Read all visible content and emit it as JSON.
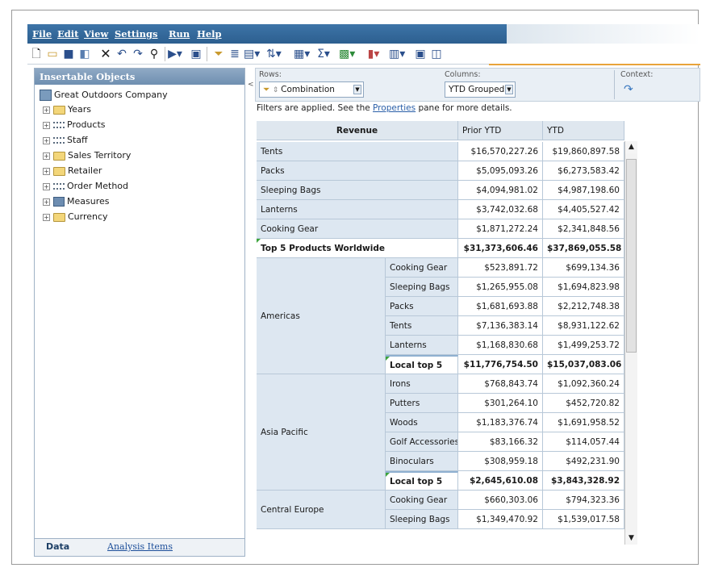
{
  "menu": {
    "file": "File",
    "edit": "Edit",
    "view": "View",
    "settings": "Settings",
    "run": "Run",
    "help": "Help"
  },
  "toolbar": {
    "icons": [
      "new-icon",
      "open-icon",
      "save-icon",
      "save-as-icon",
      "delete-icon",
      "undo-icon",
      "redo-icon",
      "find-icon",
      "run-icon",
      "export-icon",
      "filter-icon",
      "suppress-icon",
      "explore-icon",
      "sort-icon",
      "chart-type-icon",
      "summarize-icon",
      "insert-chart-icon",
      "chart-icon",
      "display-icon",
      "calculate-icon",
      "insert-member-icon"
    ]
  },
  "left_panel": {
    "title": "Insertable Objects",
    "root": "Great Outdoors Company",
    "items": [
      {
        "label": "Years",
        "icon": "folder-icon"
      },
      {
        "label": "Products",
        "icon": "hierarchy-icon"
      },
      {
        "label": "Staff",
        "icon": "hierarchy-icon"
      },
      {
        "label": "Sales Territory",
        "icon": "folder-icon"
      },
      {
        "label": "Retailer",
        "icon": "folder-icon"
      },
      {
        "label": "Order Method",
        "icon": "hierarchy-icon"
      },
      {
        "label": "Measures",
        "icon": "measures-icon"
      },
      {
        "label": "Currency",
        "icon": "folder-icon"
      }
    ],
    "tabs": {
      "data": "Data",
      "analysis": "Analysis Items"
    }
  },
  "overview": {
    "rows_label": "Rows:",
    "rows_value": "Combination",
    "columns_label": "Columns:",
    "columns_value": "YTD Grouped",
    "context_label": "Context:"
  },
  "filters": {
    "prefix": "Filters are applied. See the ",
    "link": "Properties",
    "suffix": " pane for more details."
  },
  "crosstab": {
    "corner": "Revenue",
    "col1": "Prior YTD",
    "col2": "YTD",
    "top_rows": [
      {
        "label": "Tents",
        "prior": "$16,570,227.26",
        "ytd": "$19,860,897.58"
      },
      {
        "label": "Packs",
        "prior": "$5,095,093.26",
        "ytd": "$6,273,583.42"
      },
      {
        "label": "Sleeping Bags",
        "prior": "$4,094,981.02",
        "ytd": "$4,987,198.60"
      },
      {
        "label": "Lanterns",
        "prior": "$3,742,032.68",
        "ytd": "$4,405,527.42"
      },
      {
        "label": "Cooking Gear",
        "prior": "$1,871,272.24",
        "ytd": "$2,341,848.56"
      }
    ],
    "top_total": {
      "label": "Top 5 Products Worldwide",
      "prior": "$31,373,606.46",
      "ytd": "$37,869,055.58"
    },
    "groups": [
      {
        "name": "Americas",
        "rows": [
          {
            "label": "Cooking Gear",
            "prior": "$523,891.72",
            "ytd": "$699,134.36"
          },
          {
            "label": "Sleeping Bags",
            "prior": "$1,265,955.08",
            "ytd": "$1,694,823.98"
          },
          {
            "label": "Packs",
            "prior": "$1,681,693.88",
            "ytd": "$2,212,748.38"
          },
          {
            "label": "Tents",
            "prior": "$7,136,383.14",
            "ytd": "$8,931,122.62"
          },
          {
            "label": "Lanterns",
            "prior": "$1,168,830.68",
            "ytd": "$1,499,253.72"
          }
        ],
        "total": {
          "label": "Local top 5",
          "prior": "$11,776,754.50",
          "ytd": "$15,037,083.06"
        }
      },
      {
        "name": "Asia Pacific",
        "rows": [
          {
            "label": "Irons",
            "prior": "$768,843.74",
            "ytd": "$1,092,360.24"
          },
          {
            "label": "Putters",
            "prior": "$301,264.10",
            "ytd": "$452,720.82"
          },
          {
            "label": "Woods",
            "prior": "$1,183,376.74",
            "ytd": "$1,691,958.52"
          },
          {
            "label": "Golf Accessories",
            "prior": "$83,166.32",
            "ytd": "$114,057.44"
          },
          {
            "label": "Binoculars",
            "prior": "$308,959.18",
            "ytd": "$492,231.90"
          }
        ],
        "total": {
          "label": "Local top 5",
          "prior": "$2,645,610.08",
          "ytd": "$3,843,328.92"
        }
      },
      {
        "name": "Central Europe",
        "rows": [
          {
            "label": "Cooking Gear",
            "prior": "$660,303.06",
            "ytd": "$794,323.36"
          },
          {
            "label": "Sleeping Bags",
            "prior": "$1,349,470.92",
            "ytd": "$1,539,017.58"
          }
        ]
      }
    ]
  }
}
